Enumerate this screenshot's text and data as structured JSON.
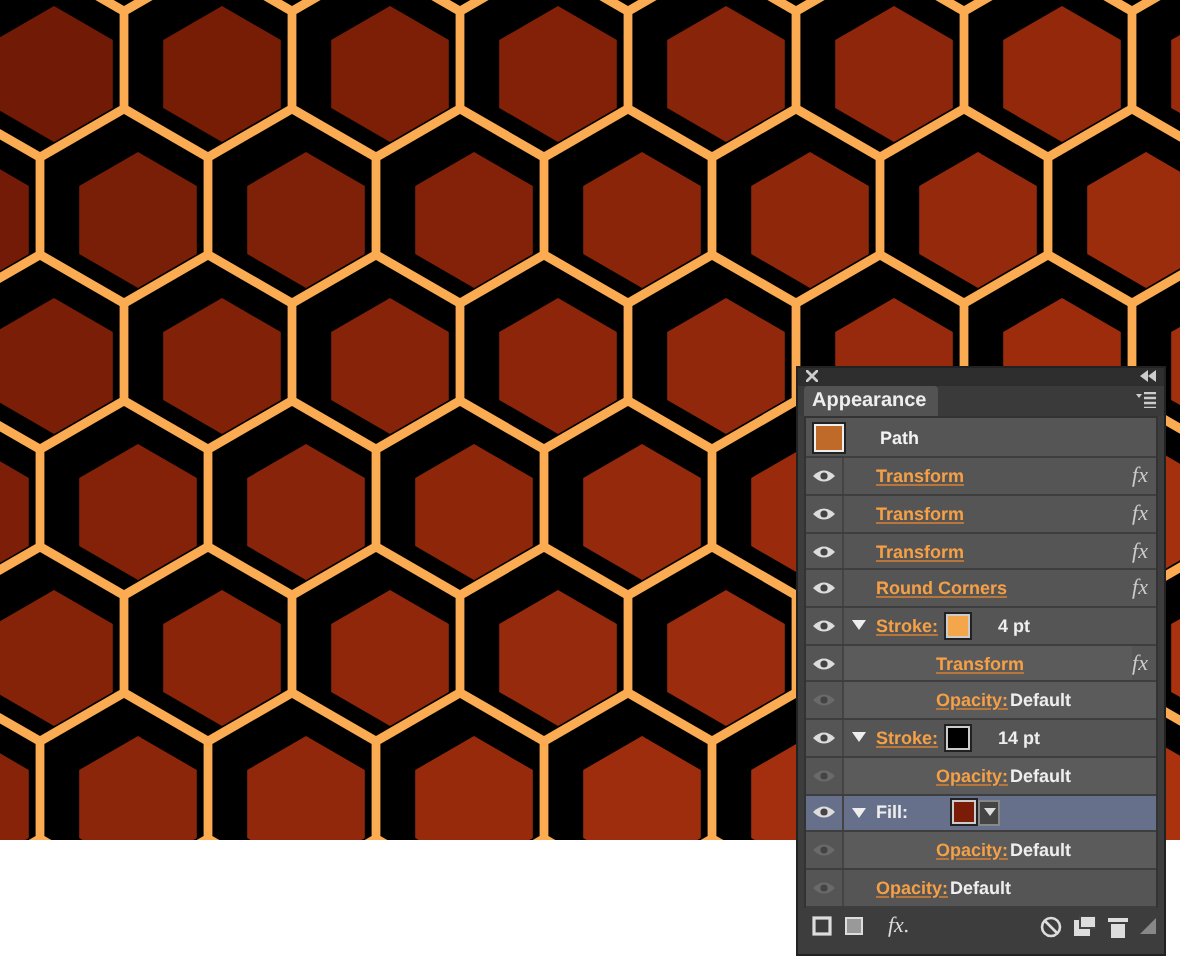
{
  "panel": {
    "title": "Appearance",
    "object": "Path",
    "items": [
      {
        "kind": "effect",
        "label": "Transform",
        "fx": "fx",
        "visible": true,
        "selected": false
      },
      {
        "kind": "effect",
        "label": "Transform",
        "fx": "fx",
        "visible": true,
        "selected": false
      },
      {
        "kind": "effect",
        "label": "Transform",
        "fx": "fx",
        "visible": true,
        "selected": false
      },
      {
        "kind": "effect",
        "label": "Round Corners",
        "fx": "fx",
        "visible": true,
        "selected": false
      },
      {
        "kind": "stroke",
        "label": "Stroke:",
        "color": "#f4a64a",
        "value": "4 pt",
        "visible": true,
        "selected": false,
        "expanded": true,
        "children": [
          {
            "kind": "effect",
            "label": "Transform",
            "fx": "fx",
            "visible": true,
            "selected": false
          },
          {
            "kind": "opacity",
            "label": "Opacity:",
            "value": "Default",
            "visible": false,
            "selected": false
          }
        ]
      },
      {
        "kind": "stroke",
        "label": "Stroke:",
        "color": "#000000",
        "value": "14 pt",
        "visible": true,
        "selected": false,
        "expanded": true,
        "children": [
          {
            "kind": "opacity",
            "label": "Opacity:",
            "value": "Default",
            "visible": false,
            "selected": false
          }
        ]
      },
      {
        "kind": "fill",
        "label": "Fill:",
        "color": "#7a1c08",
        "visible": true,
        "selected": true,
        "expanded": true,
        "children": [
          {
            "kind": "opacity",
            "label": "Opacity:",
            "value": "Default",
            "visible": false,
            "selected": false
          }
        ]
      },
      {
        "kind": "opacity",
        "label": "Opacity:",
        "value": "Default",
        "visible": false,
        "selected": false
      }
    ],
    "fx_menu": "fx."
  }
}
